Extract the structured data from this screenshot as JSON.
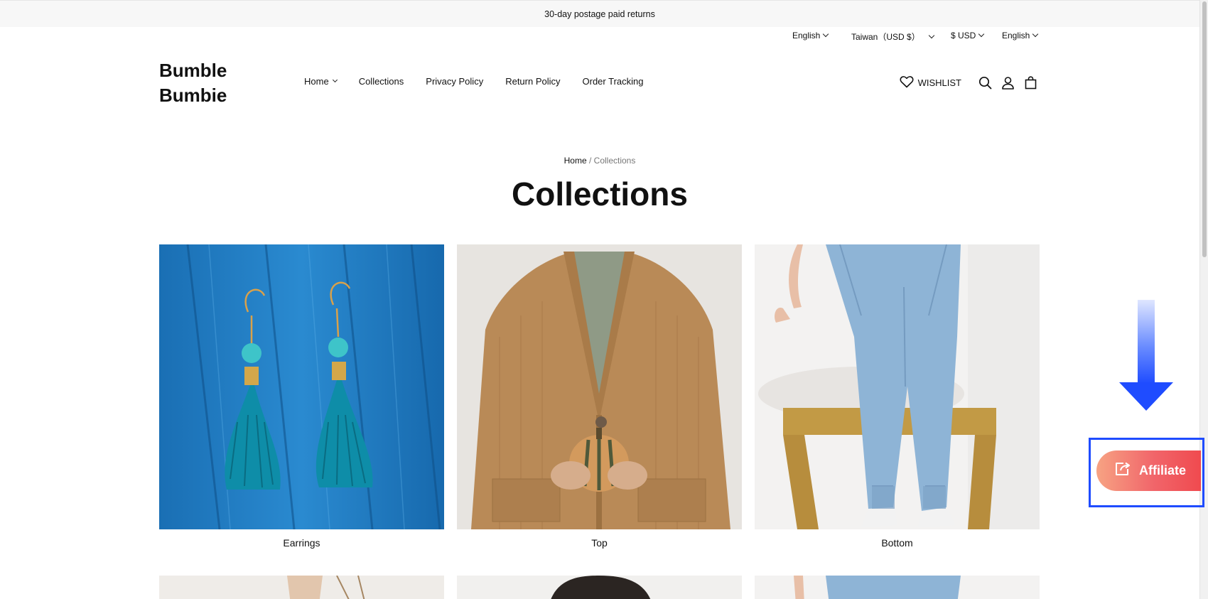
{
  "announcement": "30-day postage paid returns",
  "locale": {
    "language1": "English",
    "region": "Taiwan（USD $）",
    "currency": "$ USD",
    "language2": "English"
  },
  "brand": {
    "line1": "Bumble",
    "line2": "Bumbie"
  },
  "nav": {
    "home": "Home",
    "collections": "Collections",
    "privacy": "Privacy Policy",
    "returns": "Return Policy",
    "tracking": "Order Tracking"
  },
  "tools": {
    "wishlist": "WISHLIST"
  },
  "breadcrumb": {
    "home": "Home",
    "separator": " / ",
    "current": "Collections"
  },
  "page_title": "Collections",
  "collections": [
    {
      "label": "Earrings",
      "image": "earrings-photo"
    },
    {
      "label": "Top",
      "image": "cardigan-photo"
    },
    {
      "label": "Bottom",
      "image": "jeans-photo"
    }
  ],
  "affiliate": {
    "label": "Affiliate",
    "icon": "share-icon"
  },
  "colors": {
    "affiliate_start": "#f7a383",
    "affiliate_end": "#f04a4f",
    "highlight_border": "#1f4cff"
  }
}
